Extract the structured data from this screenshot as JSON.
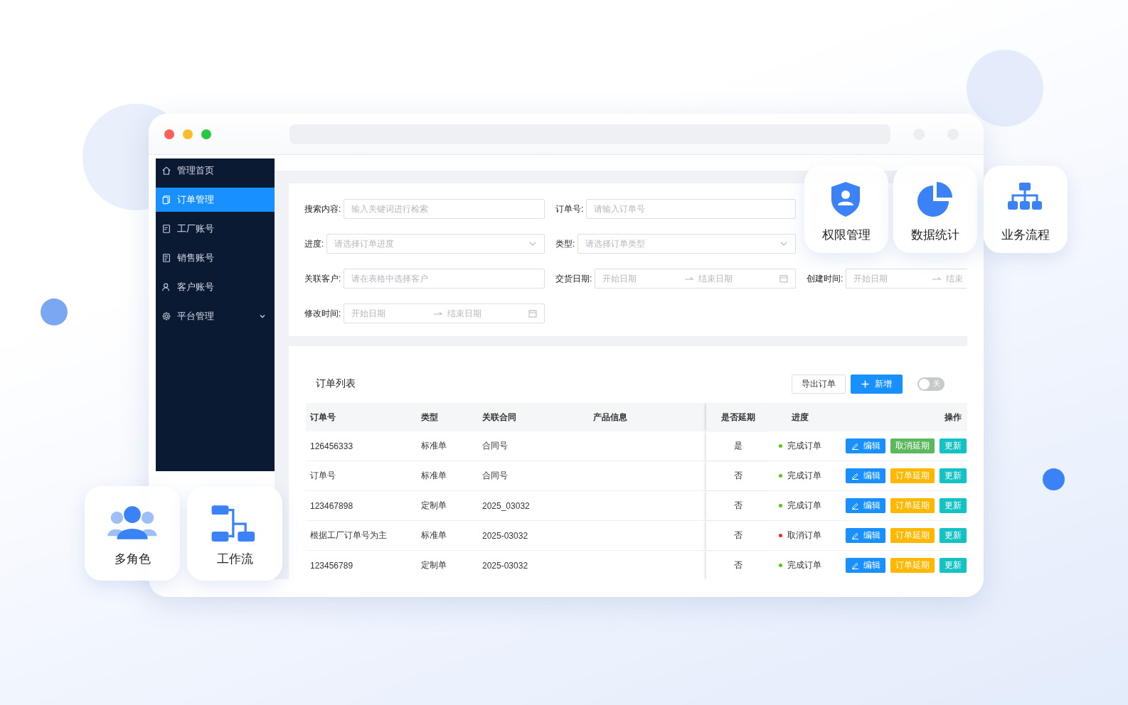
{
  "sidebar": {
    "items": [
      {
        "label": "管理首页",
        "selected": false,
        "kind": "link"
      },
      {
        "label": "订单管理",
        "selected": true,
        "kind": "link"
      },
      {
        "label": "工厂账号",
        "selected": false,
        "kind": "link"
      },
      {
        "label": "销售账号",
        "selected": false,
        "kind": "link"
      },
      {
        "label": "客户账号",
        "selected": false,
        "kind": "link"
      },
      {
        "label": "平台管理",
        "selected": false,
        "kind": "submenu"
      }
    ]
  },
  "filters": {
    "rows": [
      [
        {
          "kind": "text",
          "label": "搜索内容:",
          "placeholder": "输入关键词进行检索"
        },
        {
          "kind": "text",
          "label": "订单号:",
          "placeholder": "请输入订单号"
        }
      ],
      [
        {
          "kind": "select",
          "label": "进度:",
          "placeholder": "请选择订单进度"
        },
        {
          "kind": "select",
          "label": "类型:",
          "placeholder": "请选择订单类型"
        }
      ],
      [
        {
          "kind": "text",
          "label": "关联客户:",
          "placeholder": "请在表格中选择客户"
        },
        {
          "kind": "daterange",
          "label": "交货日期:",
          "start_placeholder": "开始日期",
          "end_placeholder": "结束日期"
        },
        {
          "kind": "daterange_cut",
          "label": "创建时间:",
          "start_placeholder": "开始日期",
          "end_placeholder": "结束"
        }
      ],
      [
        {
          "kind": "daterange",
          "label": "修改时间:",
          "start_placeholder": "开始日期",
          "end_placeholder": "结束日期"
        }
      ]
    ]
  },
  "table": {
    "title": "订单列表",
    "buttons": [
      {
        "label": "导出订单",
        "kind": "default"
      },
      {
        "label": "新增",
        "kind": "primary"
      }
    ],
    "toggle": {
      "label": "关",
      "on": false
    },
    "columns": [
      "订单号",
      "类型",
      "关联合同",
      "产品信息",
      "是否延期",
      "进度",
      "操作"
    ],
    "rows": [
      {
        "order_no": "126456333",
        "type": "标准单",
        "contract": "合同号",
        "delayed": "是",
        "status": "完成订单",
        "color": "#52c41a",
        "actions": [
          {
            "label": "编辑",
            "kind": "edit"
          },
          {
            "label": "取消延期",
            "kind": "cancel_delay"
          },
          {
            "label": "更新",
            "kind": "update"
          }
        ]
      },
      {
        "order_no": "订单号",
        "type": "标准单",
        "contract": "合同号",
        "delayed": "否",
        "status": "完成订单",
        "color": "#52c41a",
        "actions": [
          {
            "label": "编辑",
            "kind": "edit"
          },
          {
            "label": "订单延期",
            "kind": "delay"
          },
          {
            "label": "更新",
            "kind": "update"
          }
        ]
      },
      {
        "order_no": "123467898",
        "type": "定制单",
        "contract": "2025_03032",
        "delayed": "否",
        "status": "完成订单",
        "color": "#52c41a",
        "actions": [
          {
            "label": "编辑",
            "kind": "edit"
          },
          {
            "label": "订单延期",
            "kind": "delay"
          },
          {
            "label": "更新",
            "kind": "update"
          }
        ]
      },
      {
        "order_no": "根据工厂订单号为主",
        "type": "标准单",
        "contract": "2025-03032",
        "delayed": "否",
        "status": "取消订单",
        "color": "#f5222d",
        "actions": [
          {
            "label": "编辑",
            "kind": "edit"
          },
          {
            "label": "订单延期",
            "kind": "delay"
          },
          {
            "label": "更新",
            "kind": "update"
          }
        ]
      },
      {
        "order_no": "123456789",
        "type": "定制单",
        "contract": "2025-03032",
        "delayed": "否",
        "status": "完成订单",
        "color": "#52c41a",
        "actions": [
          {
            "label": "编辑",
            "kind": "edit"
          },
          {
            "label": "订单延期",
            "kind": "delay"
          },
          {
            "label": "更新",
            "kind": "update"
          }
        ]
      }
    ]
  },
  "features": [
    {
      "label": "权限管理",
      "kind": "shield"
    },
    {
      "label": "数据统计",
      "kind": "pie"
    },
    {
      "label": "业务流程",
      "kind": "org"
    },
    {
      "label": "多角色",
      "kind": "people"
    },
    {
      "label": "工作流",
      "kind": "flow"
    }
  ]
}
